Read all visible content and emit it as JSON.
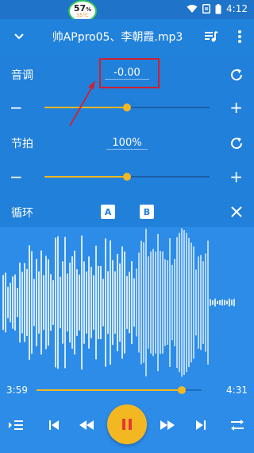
{
  "status_bar": {
    "battery_percent": "57",
    "battery_unit": "%",
    "temperature": "55°C",
    "time": "4:12"
  },
  "header": {
    "title": "帅APpro05、李朝霞.mp3"
  },
  "pitch": {
    "label": "音调",
    "value": "-0.00",
    "slider_level": 0.5
  },
  "tempo": {
    "label": "节拍",
    "value": "100%",
    "slider_level": 0.5
  },
  "loop": {
    "label": "循环",
    "a_label": "A",
    "b_label": "B"
  },
  "playback": {
    "current_time": "3:59",
    "total_time": "4:31",
    "progress": 0.8819
  },
  "colors": {
    "accent": "#f3b722",
    "primary": "#2180da",
    "annotation": "#d0202f"
  },
  "icons": [
    "chevron-down-icon",
    "playlist-icon",
    "more-vert-icon",
    "reset-icon",
    "close-icon",
    "queue-icon",
    "skip-previous-icon",
    "rewind-icon",
    "pause-icon",
    "fast-forward-icon",
    "skip-next-icon",
    "shuffle-icon",
    "wifi-icon",
    "sim-icon",
    "battery-icon"
  ]
}
